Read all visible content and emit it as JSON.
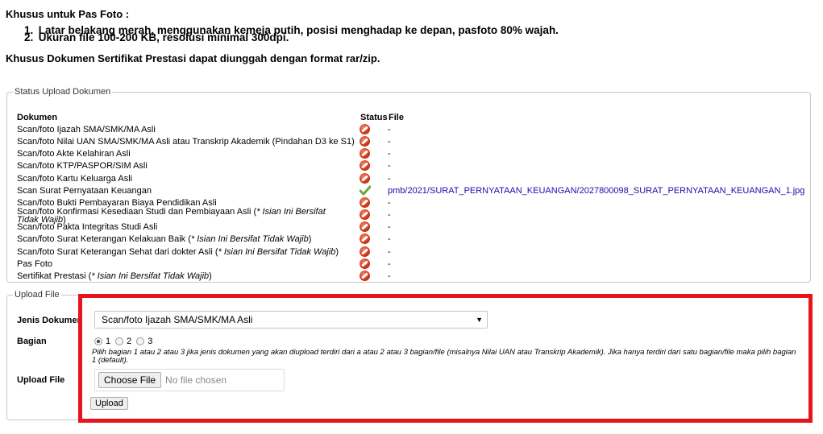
{
  "pas_foto_title": "Khusus untuk Pas Foto :",
  "pas_foto_rules": [
    {
      "num": "1.",
      "text": "Latar belakang merah, menggunakan kemeja putih, posisi menghadap ke depan, pasfoto 80% wajah."
    },
    {
      "num": "2.",
      "text": "Ukuran file 100-200 KB, resolusi minimal 300dpi."
    }
  ],
  "sertifikat_note": "Khusus Dokumen Sertifikat Prestasi dapat diunggah dengan format rar/zip.",
  "status_upload": {
    "legend": "Status Upload Dokumen",
    "col_dokumen": "Dokumen",
    "col_status": "Status",
    "col_file": "File",
    "rows": [
      {
        "name": "Scan/foto Ijazah SMA/SMK/MA Asli",
        "note": "",
        "status": "missing",
        "file": "-"
      },
      {
        "name": "Scan/foto Nilai UAN SMA/SMK/MA Asli atau Transkrip Akademik (Pindahan D3 ke S1)",
        "note": "",
        "status": "missing",
        "file": "-"
      },
      {
        "name": "Scan/foto Akte Kelahiran Asli",
        "note": "",
        "status": "missing",
        "file": "-"
      },
      {
        "name": "Scan/foto KTP/PASPOR/SIM Asli",
        "note": "",
        "status": "missing",
        "file": "-"
      },
      {
        "name": "Scan/foto Kartu Keluarga Asli",
        "note": "",
        "status": "missing",
        "file": "-"
      },
      {
        "name": "Scan Surat Pernyataan Keuangan",
        "note": "",
        "status": "uploaded",
        "file": "pmb/2021/SURAT_PERNYATAAN_KEUANGAN/2027800098_SURAT_PERNYATAAN_KEUANGAN_1.jpg"
      },
      {
        "name": "Scan/foto Bukti Pembayaran Biaya Pendidikan Asli",
        "note": "",
        "status": "missing",
        "file": "-"
      },
      {
        "name": "Scan/foto Konfirmasi Kesediaan Studi dan Pembiayaan Asli",
        "note": "* Isian Ini Bersifat Tidak Wajib",
        "status": "missing",
        "file": "-",
        "two_line": true
      },
      {
        "name": "Scan/foto Pakta Integritas Studi Asli",
        "note": "",
        "status": "missing",
        "file": "-"
      },
      {
        "name": "Scan/foto Surat Keterangan Kelakuan Baik",
        "note": "* Isian Ini Bersifat Tidak Wajib",
        "status": "missing",
        "file": "-"
      },
      {
        "name": "Scan/foto Surat Keterangan Sehat dari dokter Asli",
        "note": "* Isian Ini Bersifat Tidak Wajib",
        "status": "missing",
        "file": "-"
      },
      {
        "name": "Pas Foto",
        "note": "",
        "status": "missing",
        "file": "-"
      },
      {
        "name": "Sertifikat Prestasi",
        "note": "* Isian Ini Bersifat Tidak Wajib",
        "status": "missing",
        "file": "-"
      }
    ]
  },
  "upload_file": {
    "legend": "Upload File",
    "jenis_label": "Jenis Dokumen",
    "jenis_selected": "Scan/foto Ijazah SMA/SMK/MA Asli",
    "bagian_label": "Bagian",
    "bagian_options": [
      "1",
      "2",
      "3"
    ],
    "bagian_selected": "1",
    "bagian_hint": "Pilih bagian 1 atau 2 atau 3 jika jenis dokumen yang akan diupload terdiri dari a atau 2 atau 3 bagian/file (misalnya Nilai UAN atau Transkrip Akademik). Jika hanya terdiri dari satu bagian/file maka pilih bagian 1 (default).",
    "file_label": "Upload File",
    "choose_label": "Choose File",
    "no_file_label": "No file chosen",
    "upload_button": "Upload"
  },
  "colors": {
    "highlight_border": "#e8141c",
    "link": "#1a0dab"
  }
}
